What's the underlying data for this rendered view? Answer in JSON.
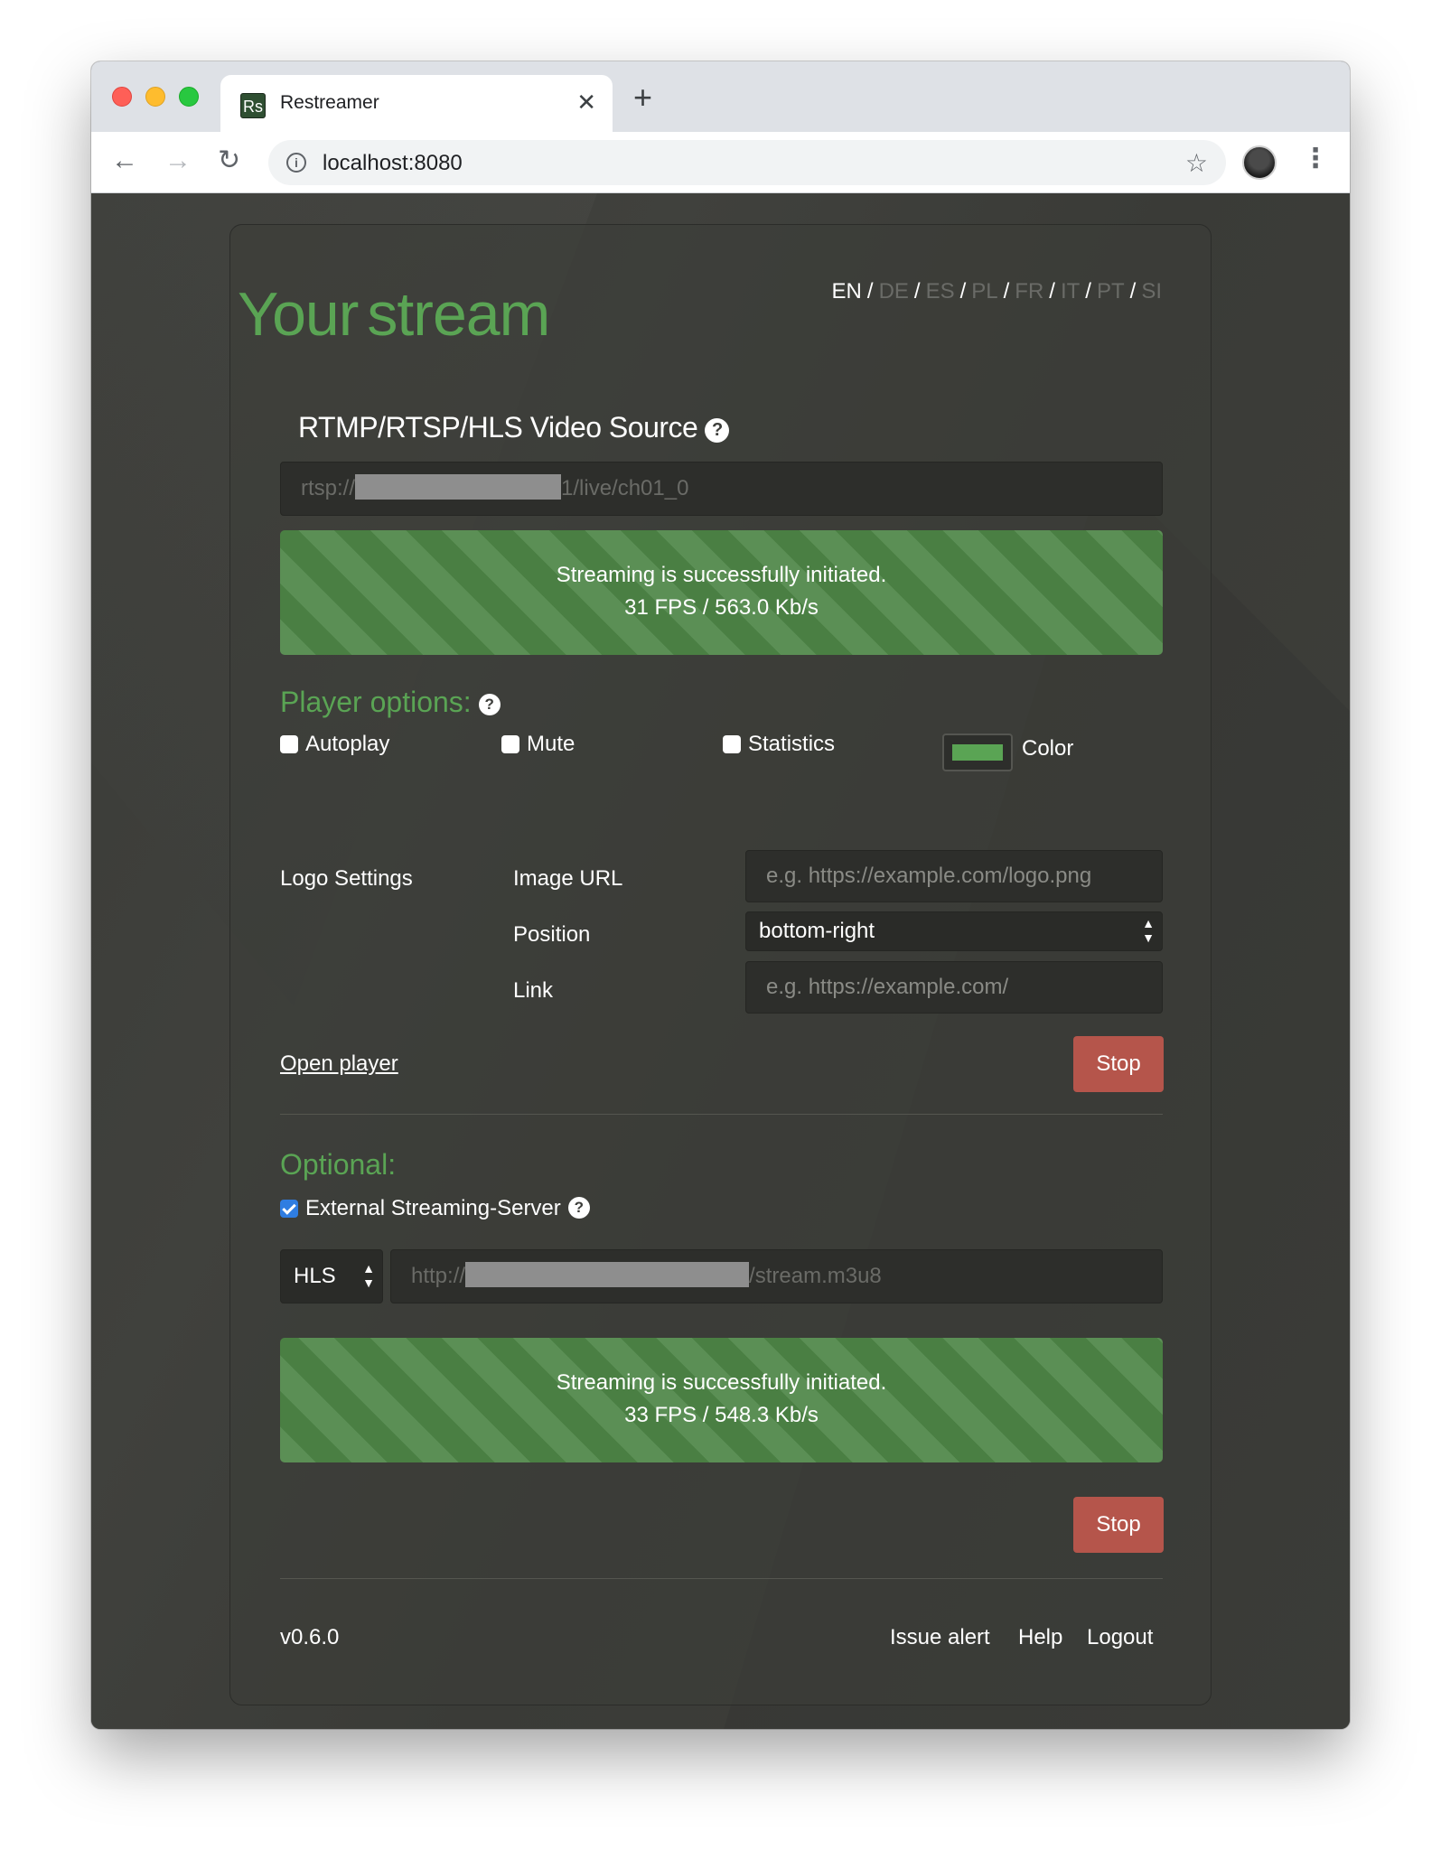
{
  "browser": {
    "tab_favicon": "Rs",
    "tab_title": "Restreamer",
    "tab_close": "✕",
    "new_tab": "+",
    "url": "localhost:8080",
    "icons": {
      "back": "arrow-left-icon",
      "forward": "arrow-right-icon",
      "reload": "reload-icon",
      "info": "info-icon",
      "bookmark": "star-icon",
      "menu": "kebab-menu-icon"
    }
  },
  "header": {
    "logo_your": "Your",
    "logo_stream": "stream",
    "languages": [
      {
        "code": "EN",
        "active": true
      },
      {
        "code": "DE",
        "active": false
      },
      {
        "code": "ES",
        "active": false
      },
      {
        "code": "PL",
        "active": false
      },
      {
        "code": "FR",
        "active": false
      },
      {
        "code": "IT",
        "active": false
      },
      {
        "code": "PT",
        "active": false
      },
      {
        "code": "SI",
        "active": false
      }
    ],
    "separator": "/"
  },
  "source": {
    "label": "RTMP/RTSP/HLS Video Source",
    "help": "?",
    "value_prefix": "rtsp://",
    "value_suffix": "1/live/ch01_0",
    "status_line1": "Streaming is successfully initiated.",
    "status_line2": "31 FPS / 563.0 Kb/s"
  },
  "player_options": {
    "heading": "Player options:",
    "help": "?",
    "autoplay": "Autoplay",
    "mute": "Mute",
    "statistics": "Statistics",
    "color_label": "Color",
    "color_value": "#5aa454"
  },
  "logo_settings": {
    "label": "Logo Settings",
    "image_url_label": "Image URL",
    "image_url_placeholder": "e.g. https://example.com/logo.png",
    "position_label": "Position",
    "position_value": "bottom-right",
    "link_label": "Link",
    "link_placeholder": "e.g. https://example.com/"
  },
  "actions": {
    "open_player": "Open player",
    "stop": "Stop"
  },
  "optional": {
    "heading": "Optional:",
    "external_label": "External Streaming-Server",
    "help": "?",
    "protocol": "HLS",
    "url_prefix": "http://",
    "url_suffix": "/stream.m3u8",
    "status_line1": "Streaming is successfully initiated.",
    "status_line2": "33 FPS / 548.3 Kb/s",
    "stop": "Stop"
  },
  "footer": {
    "version": "v0.6.0",
    "issue_alert": "Issue alert",
    "help": "Help",
    "logout": "Logout"
  },
  "colors": {
    "accent_green": "#5aa454",
    "stop_red": "#b5554b",
    "background": "#3c3d3a"
  }
}
